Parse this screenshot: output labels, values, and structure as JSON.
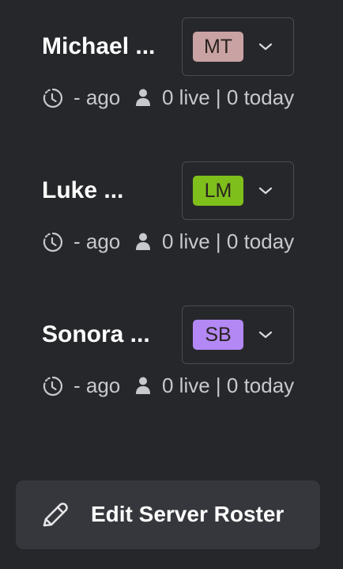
{
  "servers": [
    {
      "name": "Michael ...",
      "initials": "MT",
      "badge_color": "#c9a3a3",
      "last_seen": "- ago",
      "counts": "0 live | 0 today"
    },
    {
      "name": "Luke ...",
      "initials": "LM",
      "badge_color": "#7fbf1c",
      "last_seen": "- ago",
      "counts": "0 live | 0 today"
    },
    {
      "name": "Sonora ...",
      "initials": "SB",
      "badge_color": "#b388f5",
      "last_seen": "- ago",
      "counts": "0 live | 0 today"
    }
  ],
  "edit_button": {
    "label": "Edit Server Roster",
    "icon": "pencil-icon"
  },
  "colors": {
    "background": "#26272b",
    "button_background": "#36373c",
    "border": "#4a4b51",
    "muted_text": "#c8c9cd"
  }
}
